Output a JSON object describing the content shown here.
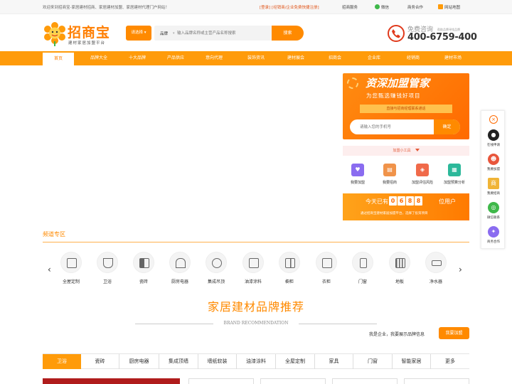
{
  "topbar": {
    "welcome": "欢迎来到招商宝-家居建材招商、家居建材加盟、家居建材代理门户网站！",
    "login": "[登录]",
    "register": "[经销商/企业免费快捷注册]",
    "links": [
      "招商服务",
      "微信",
      "商务合作",
      "网站地图"
    ]
  },
  "logo": {
    "brand": "招商宝",
    "slogan": "建材家居加盟平台"
  },
  "search": {
    "category": "请选择",
    "field_label": "品牌",
    "placeholder": "输入品牌名称或主营产品名称搜索",
    "button": "搜索"
  },
  "hotline": {
    "label": "免费咨询",
    "sub": "帮助品牌寻找品牌",
    "number": "400-6759-400"
  },
  "nav": [
    "首页",
    "品牌大全",
    "十大品牌",
    "产品供应",
    "意向代理",
    "装饰资讯",
    "建材展会",
    "招商会",
    "企业库",
    "经销商",
    "建材市场"
  ],
  "promo": {
    "title": "资深加盟管家",
    "subtitle": "为您甄选赚钱好项目",
    "ribbon": "直接与招商经理联系通话",
    "phone_placeholder": "请输入您的手机号",
    "submit": "确定"
  },
  "tools": {
    "heading": "加盟小工具",
    "items": [
      {
        "label": "我要加盟",
        "icon": "heart-icon",
        "color": "#8a6cf0"
      },
      {
        "label": "我要招商",
        "icon": "document-icon",
        "color": "#f0934a"
      },
      {
        "label": "加盟评估风险",
        "icon": "shield-icon",
        "color": "#f06a4a"
      },
      {
        "label": "加盟预算分析",
        "icon": "calculator-icon",
        "color": "#2cb89a"
      }
    ]
  },
  "counter": {
    "lead": "今天已有",
    "digits": [
      "0",
      "6",
      "8",
      "8"
    ],
    "tail": "位用户",
    "note": "通过招商宝建材家居加盟平台，选择了投资项目"
  },
  "side": {
    "items": [
      {
        "label": "在线申请",
        "icon": "qq-icon",
        "color": "#222222"
      },
      {
        "label": "我要加盟",
        "icon": "users-icon",
        "color": "#e8563c"
      },
      {
        "label": "我要招商",
        "icon": "shop-icon",
        "color": "#f0b437"
      },
      {
        "label": "微信联系",
        "icon": "wechat-icon",
        "color": "#3fb84a"
      },
      {
        "label": "商务合作",
        "icon": "handshake-icon",
        "color": "#8a6cf0"
      }
    ]
  },
  "zone": {
    "title": "频道专区",
    "categories": [
      "全屋定制",
      "卫浴",
      "瓷砖",
      "厨房电器",
      "集成吊顶",
      "油漆涂料",
      "橱柜",
      "衣柜",
      "门窗",
      "地板",
      "净水器"
    ]
  },
  "recommend": {
    "title": "家居建材品牌推荐",
    "subtitle": "BRAND RECOMMENDATION",
    "join_text": "我是企业，我要展示品牌信息",
    "join_button": "我要加盟",
    "tabs": [
      "卫浴",
      "瓷砖",
      "厨房电器",
      "集成顶墙",
      "墙纸软装",
      "油漆涂料",
      "全屋定制",
      "家具",
      "门窗",
      "智能家居",
      "更多"
    ]
  },
  "colors": {
    "accent": "#ff9b0a",
    "brand": "#ff7e00"
  }
}
